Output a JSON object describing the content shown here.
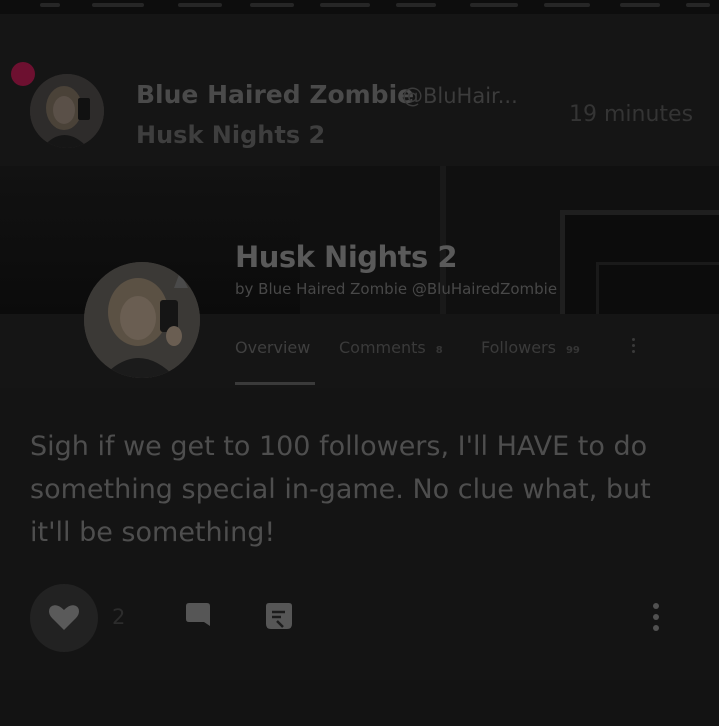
{
  "post": {
    "author_name": "Blue Haired Zombie",
    "author_handle": "@BluHair...",
    "time": "19 minutes",
    "story_title": "Husk Nights 2"
  },
  "story": {
    "title": "Husk Nights 2",
    "byline": "by Blue Haired Zombie @BluHairedZombie"
  },
  "tabs": [
    {
      "label": "Overview",
      "count": ""
    },
    {
      "label": "Comments",
      "count": "8"
    },
    {
      "label": "Followers",
      "count": "99"
    }
  ],
  "body": "Sigh if we get to 100 followers, I'll HAVE to do something special in-game. No clue what, but it'll be something!",
  "actions": {
    "like_count": "2",
    "icons": [
      "heart-icon",
      "comment-icon",
      "share-icon",
      "more-icon"
    ]
  },
  "colors": {
    "background": "#141414",
    "notification_dot": "#6d1030"
  }
}
